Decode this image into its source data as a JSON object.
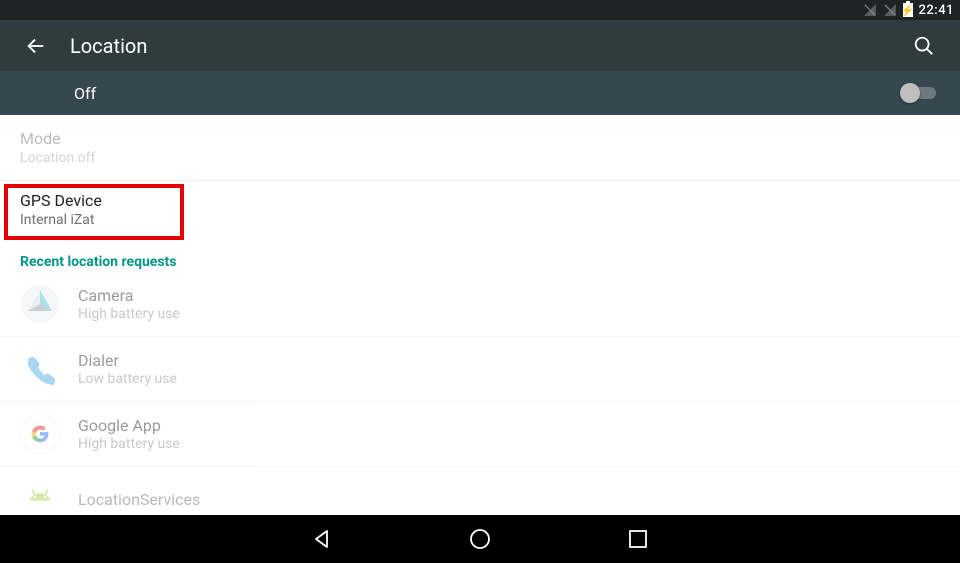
{
  "status": {
    "time": "22:41"
  },
  "appbar": {
    "title": "Location"
  },
  "location_switch": {
    "label": "Off",
    "on": false
  },
  "mode": {
    "title": "Mode",
    "sub": "Location off"
  },
  "gps": {
    "title": "GPS Device",
    "sub": "Internal iZat"
  },
  "section": {
    "recent": "Recent location requests"
  },
  "apps": {
    "camera": {
      "title": "Camera",
      "sub": "High battery use"
    },
    "dialer": {
      "title": "Dialer",
      "sub": "Low battery use"
    },
    "google": {
      "title": "Google App",
      "sub": "High battery use"
    },
    "locsvc": {
      "title": "LocationServices",
      "sub": ""
    }
  }
}
